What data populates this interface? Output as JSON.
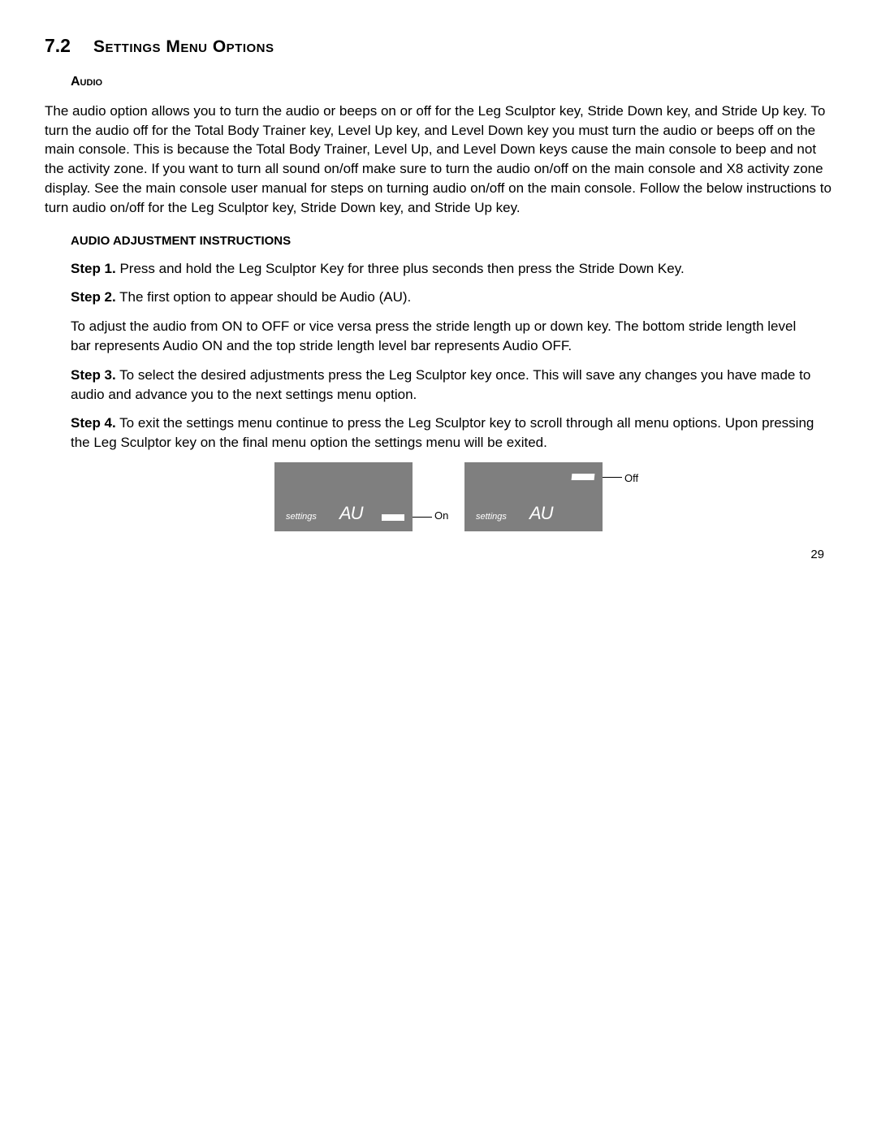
{
  "section": {
    "number": "7.2",
    "title": "Settings Menu Options"
  },
  "subsection": {
    "title": "Audio"
  },
  "intro": "The audio option allows you to turn the audio or beeps on or off for the Leg Sculptor key, Stride Down key, and Stride Up key. To turn the audio off for the Total Body Trainer key, Level Up key, and Level Down key you must turn the audio or beeps off on the main console. This is because the Total Body Trainer, Level Up, and Level Down keys cause the main console to beep and not the activity zone. If you want to turn all sound on/off make sure to turn the audio on/off on the main console and X8 activity zone display. See the main console user manual for steps on turning audio on/off on the main console. Follow the below instructions to turn audio on/off for the Leg Sculptor key, Stride Down key, and Stride Up key.",
  "instructions_heading": "AUDIO ADJUSTMENT INSTRUCTIONS",
  "steps": {
    "s1_label": "Step 1.",
    "s1_text": " Press and hold the Leg Sculptor Key for three plus seconds then press the Stride Down Key.",
    "s2_label": "Step 2.",
    "s2_text": " The first option to appear should be Audio (AU).",
    "s2_extra": "To adjust the audio from ON to OFF or vice versa press the stride length up or down key. The bottom stride length level bar represents Audio ON and the top stride length level bar represents Audio OFF.",
    "s3_label": "Step 3.",
    "s3_text": " To select the desired adjustments press the Leg Sculptor key once. This will save any changes you have made to audio and advance you to the next settings menu option.",
    "s4_label": "Step 4.",
    "s4_text": " To exit the settings menu continue to press the Leg Sculptor key to scroll through all menu options. Upon pressing the Leg Sculptor key on the final menu option the settings menu will be exited."
  },
  "figure": {
    "settings_label": "settings",
    "au_label": "AU",
    "on_label": "On",
    "off_label": "Off"
  },
  "page_number": "29"
}
